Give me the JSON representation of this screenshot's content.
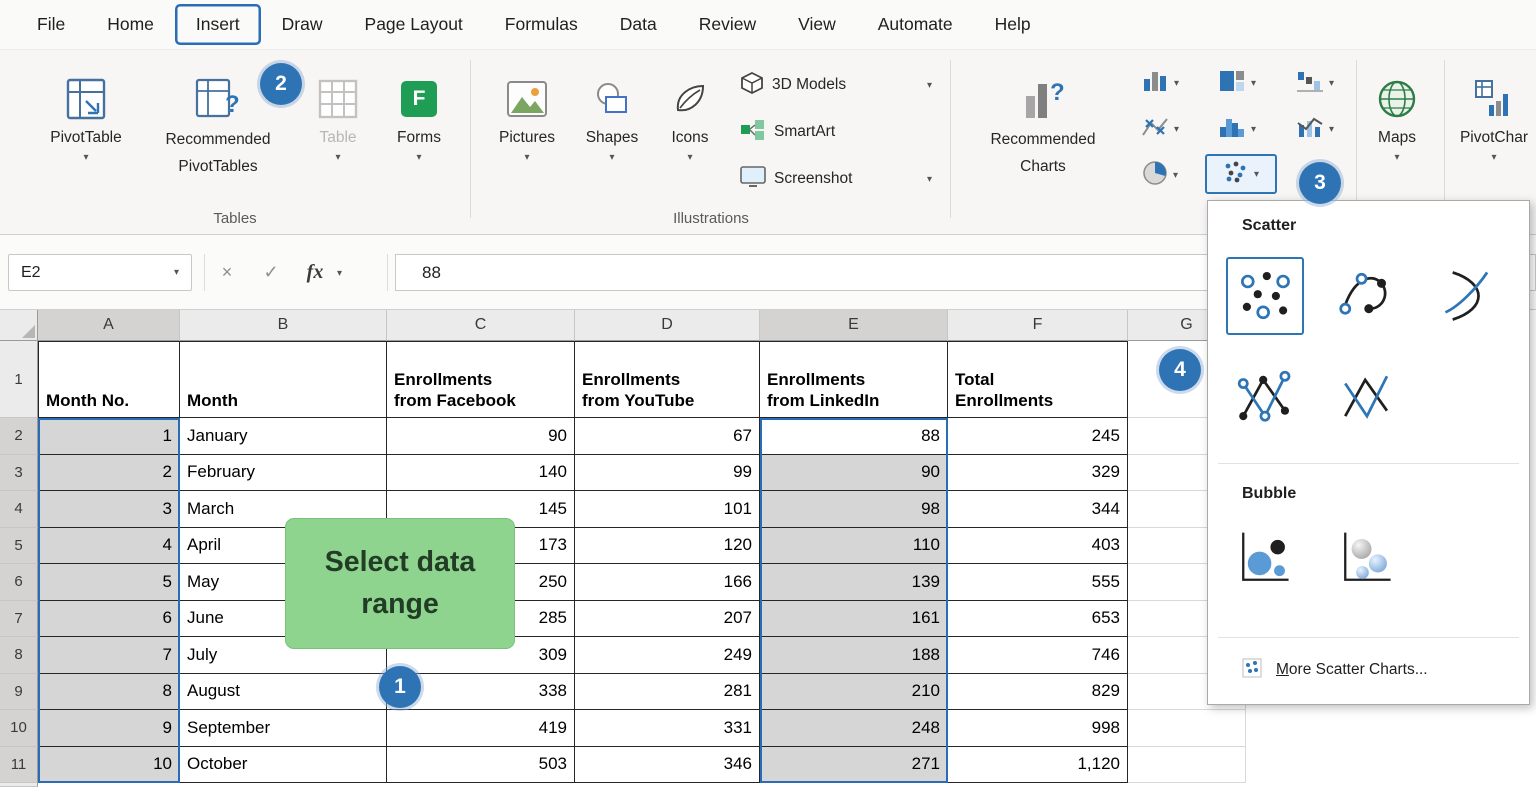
{
  "tabs": {
    "items": [
      {
        "label": "File",
        "active": false
      },
      {
        "label": "Home",
        "active": false
      },
      {
        "label": "Insert",
        "active": true
      },
      {
        "label": "Draw",
        "active": false
      },
      {
        "label": "Page Layout",
        "active": false
      },
      {
        "label": "Formulas",
        "active": false
      },
      {
        "label": "Data",
        "active": false
      },
      {
        "label": "Review",
        "active": false
      },
      {
        "label": "View",
        "active": false
      },
      {
        "label": "Automate",
        "active": false
      },
      {
        "label": "Help",
        "active": false
      }
    ]
  },
  "ribbon": {
    "group_labels": {
      "tables": "Tables",
      "illustrations": "Illustrations"
    },
    "pivottable": "PivotTable",
    "recommended_pivottables": "Recommended\nPivotTables",
    "table": "Table",
    "forms": "Forms",
    "pictures": "Pictures",
    "shapes": "Shapes",
    "icons": "Icons",
    "three_d_models": "3D Models",
    "smartart": "SmartArt",
    "screenshot": "Screenshot",
    "recommended_charts": "Recommended\nCharts",
    "maps": "Maps",
    "pivotchart": "PivotChar"
  },
  "formula_bar": {
    "name_box": "E2",
    "fx_label": "fx",
    "value": "88"
  },
  "annotations": {
    "badge1": "1",
    "badge2": "2",
    "badge3": "3",
    "badge4": "4",
    "callout": "Select data\nrange"
  },
  "scatter_menu": {
    "section_scatter": "Scatter",
    "section_bubble": "Bubble",
    "more_label_accel": "M",
    "more_label_rest": "ore Scatter Charts...",
    "scatter_option_icons": [
      "scatter",
      "scatter-smooth-lines-markers",
      "scatter-smooth-lines",
      "scatter-straight-lines-markers",
      "scatter-straight-lines"
    ],
    "bubble_option_icons": [
      "bubble",
      "bubble-3d"
    ],
    "selected_option": "scatter"
  },
  "sheet": {
    "column_headers": [
      "A",
      "B",
      "C",
      "D",
      "E",
      "F",
      "G"
    ],
    "row_headers": [
      "1",
      "2",
      "3",
      "4",
      "5",
      "6",
      "7",
      "8",
      "9",
      "10",
      "11"
    ],
    "cells": {
      "header_row": [
        "Month No.",
        "Month",
        "Enrollments\nfrom Facebook",
        "Enrollments\nfrom YouTube",
        "Enrollments\nfrom LinkedIn",
        "Total\nEnrollments"
      ],
      "data_rows": [
        [
          "1",
          "January",
          "90",
          "67",
          "88",
          "245"
        ],
        [
          "2",
          "February",
          "140",
          "99",
          "90",
          "329"
        ],
        [
          "3",
          "March",
          "145",
          "101",
          "98",
          "344"
        ],
        [
          "4",
          "April",
          "173",
          "120",
          "110",
          "403"
        ],
        [
          "5",
          "May",
          "250",
          "166",
          "139",
          "555"
        ],
        [
          "6",
          "June",
          "285",
          "207",
          "161",
          "653"
        ],
        [
          "7",
          "July",
          "309",
          "249",
          "188",
          "746"
        ],
        [
          "8",
          "August",
          "338",
          "281",
          "210",
          "829"
        ],
        [
          "9",
          "September",
          "419",
          "331",
          "248",
          "998"
        ],
        [
          "10",
          "October",
          "503",
          "346",
          "271",
          "1,120"
        ]
      ]
    },
    "selection": {
      "active_cell": "E2",
      "ranges": [
        {
          "column": "A",
          "first_row": 2,
          "last_row": 11
        },
        {
          "column": "E",
          "first_row": 2,
          "last_row": 11
        }
      ]
    }
  }
}
